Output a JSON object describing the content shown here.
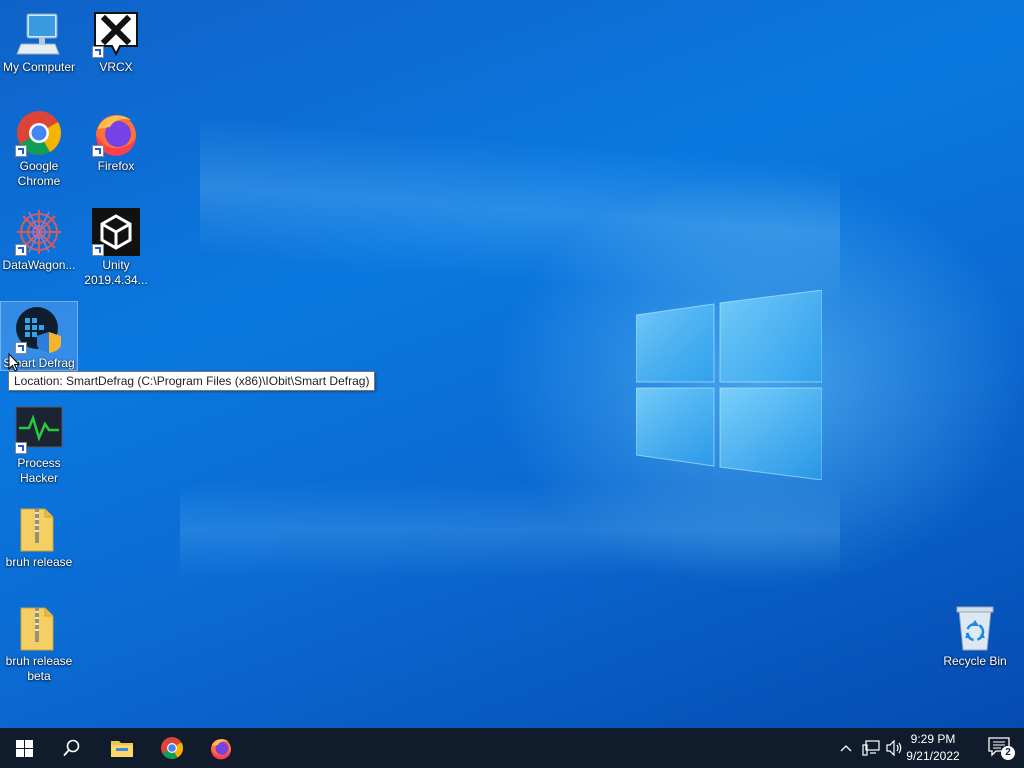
{
  "desktop": {
    "icons": [
      {
        "label": "My Computer"
      },
      {
        "label": "VRCX"
      },
      {
        "label": "Google Chrome"
      },
      {
        "label": "Firefox"
      },
      {
        "label": "DataWagon..."
      },
      {
        "label": "Unity 2019.4.34..."
      },
      {
        "label": "Smart Defrag"
      },
      {
        "label": "Process Hacker"
      },
      {
        "label": "bruh release"
      },
      {
        "label": "bruh release beta"
      },
      {
        "label": "Recycle Bin"
      }
    ],
    "tooltip": "Location: SmartDefrag (C:\\Program Files (x86)\\IObit\\Smart Defrag)"
  },
  "taskbar": {
    "pinned": [
      {
        "icon": "windows-start-icon"
      },
      {
        "icon": "search-icon"
      },
      {
        "icon": "file-explorer-icon"
      },
      {
        "icon": "chrome-icon"
      },
      {
        "icon": "firefox-icon"
      }
    ],
    "clock": {
      "time": "9:29 PM",
      "date": "9/21/2022"
    },
    "notifications_count": "2"
  },
  "colors": {
    "taskbar_bg": "#101c2c",
    "desktop_accent": "#0a78e0"
  }
}
